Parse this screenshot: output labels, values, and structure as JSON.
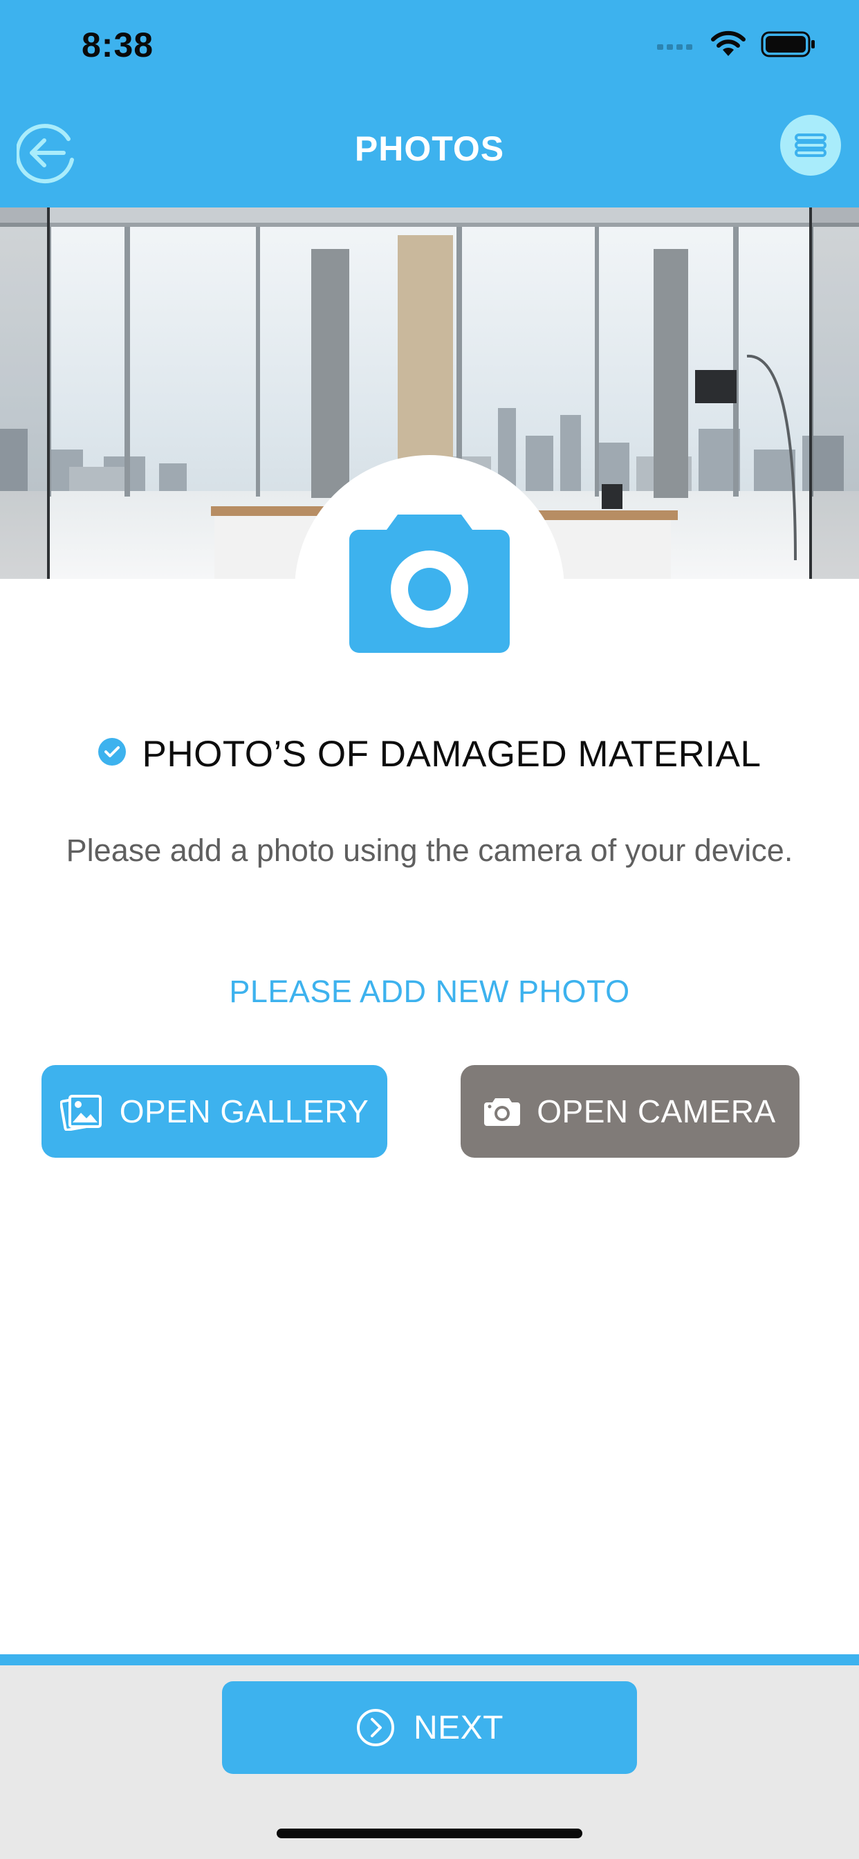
{
  "status_bar": {
    "time": "8:38"
  },
  "header": {
    "title": "PHOTOS",
    "back_icon": "back-arrow-circle-icon",
    "menu_icon": "hamburger-menu-icon"
  },
  "hero": {
    "image": "office-interior-photo",
    "badge_icon": "camera-icon"
  },
  "content": {
    "section_title": "PHOTO’S OF DAMAGED MATERIAL",
    "section_icon": "check-circle-icon",
    "description": "Please add a photo using the camera of your device.",
    "add_photo_link": "PLEASE ADD NEW PHOTO",
    "gallery_button": {
      "label": "OPEN GALLERY",
      "icon": "gallery-icon"
    },
    "camera_button": {
      "label": "OPEN CAMERA",
      "icon": "camera-icon"
    }
  },
  "footer": {
    "next_label": "NEXT",
    "next_icon": "chevron-right-circle-icon"
  },
  "colors": {
    "primary": "#3db2ee",
    "secondary_button": "#807b78",
    "menu_button_bg": "#a9ecfb",
    "footer_bg": "#e8e8e8"
  }
}
